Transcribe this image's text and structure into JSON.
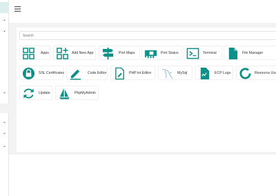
{
  "search": {
    "placeholder": "Search"
  },
  "accent": "#0e8f87",
  "apps": [
    {
      "label": "Apps",
      "icon": "apps-grid-icon"
    },
    {
      "label": "Add New App",
      "icon": "add-app-icon"
    },
    {
      "label": "Port Maps",
      "icon": "signpost-icon"
    },
    {
      "label": "Port Status",
      "icon": "network-card-icon"
    },
    {
      "label": "Terminal",
      "icon": "terminal-icon"
    },
    {
      "label": "File Manager",
      "icon": "file-icon"
    },
    {
      "label": "SSL Certificates",
      "icon": "lock-icon"
    },
    {
      "label": "Code Editor",
      "icon": "pencil-icon"
    },
    {
      "label": "PHP ini Editor",
      "icon": "file-edit-icon"
    },
    {
      "label": "MySql",
      "icon": "dolphin-icon"
    },
    {
      "label": "ECP Logs",
      "icon": "log-file-icon"
    },
    {
      "label": "Resource Usage",
      "icon": "pie-chart-icon"
    },
    {
      "label": "Update",
      "icon": "refresh-icon"
    },
    {
      "label": "PhpMyAdmin",
      "icon": "sailboat-icon"
    }
  ]
}
